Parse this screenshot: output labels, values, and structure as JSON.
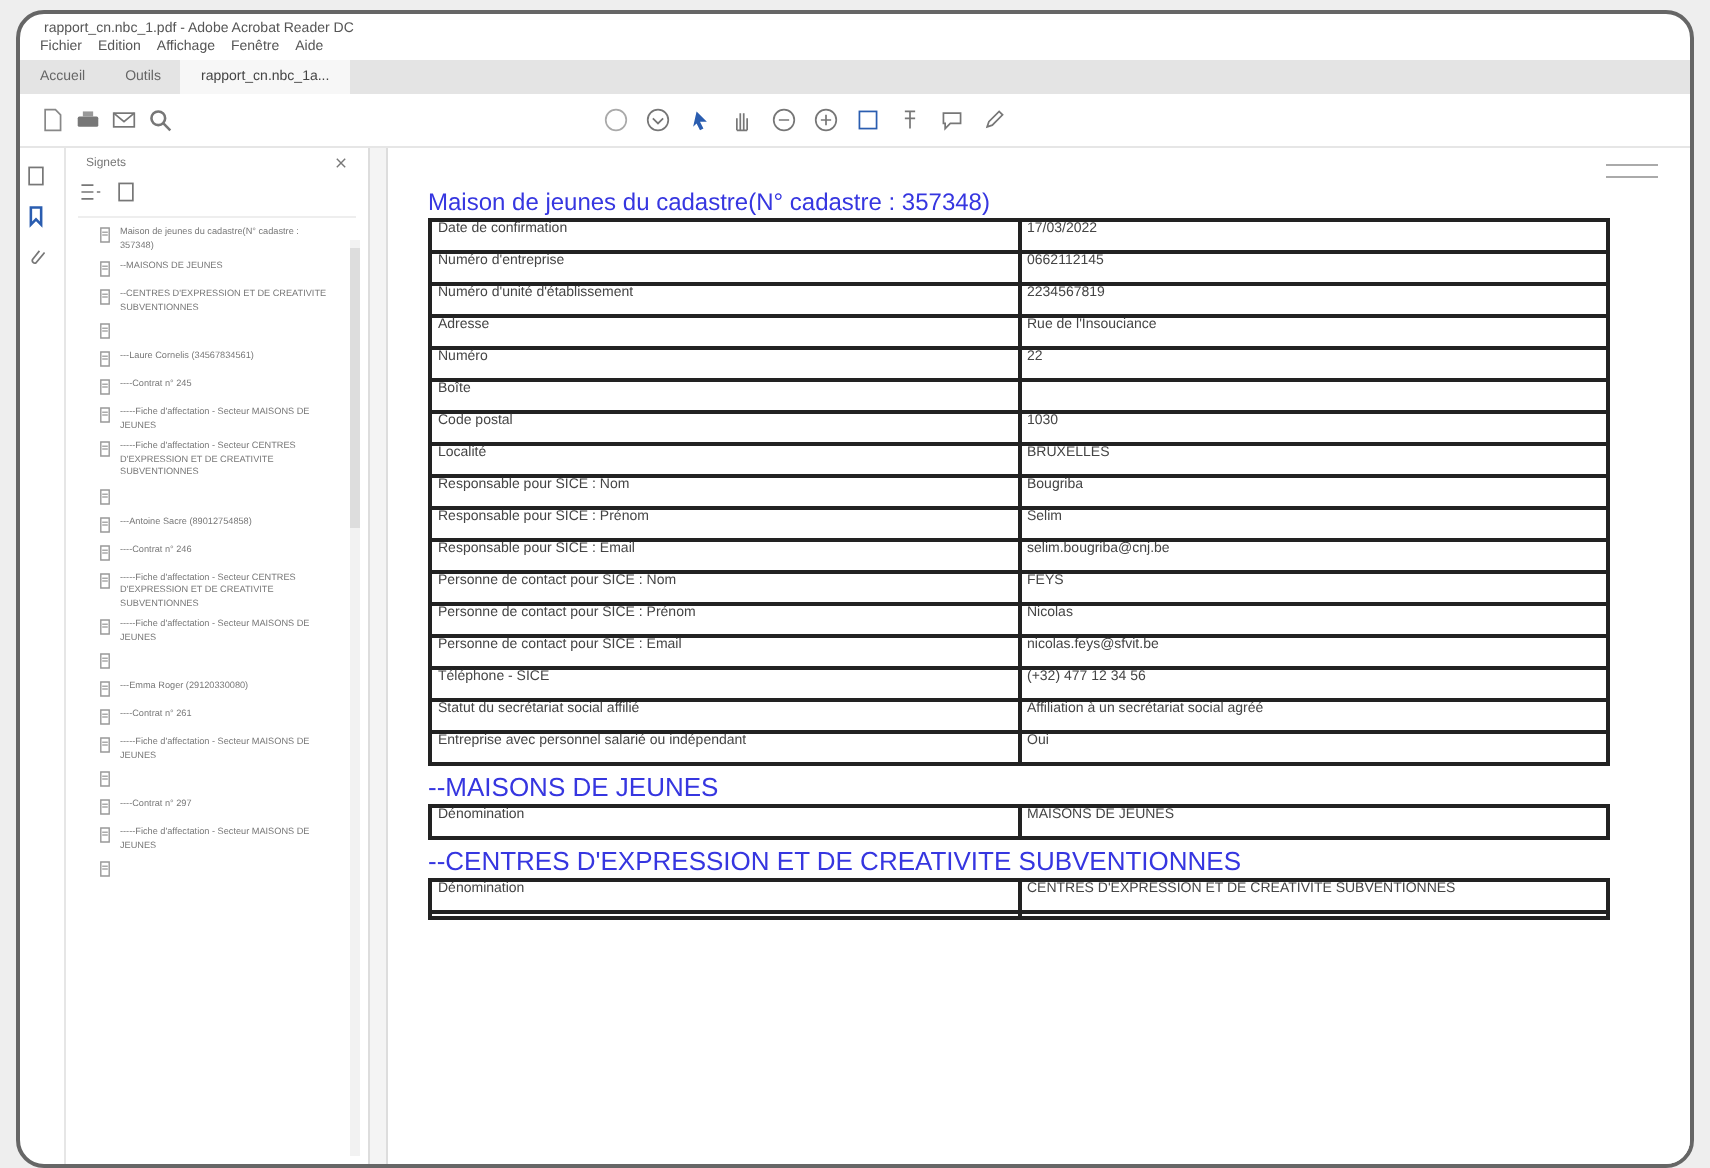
{
  "window": {
    "title": "rapport_cn.nbc_1.pdf - Adobe Acrobat Reader DC"
  },
  "menu": [
    "Fichier",
    "Edition",
    "Affichage",
    "Fenêtre",
    "Aide"
  ],
  "tabs": [
    {
      "label": "Accueil",
      "selected": false
    },
    {
      "label": "Outils",
      "selected": false
    },
    {
      "label": "rapport_cn.nbc_1a...",
      "selected": true
    }
  ],
  "sidebar": {
    "title": "Signets",
    "items": [
      {
        "kind": "labeled",
        "label": "Maison de jeunes du cadastre(N° cadastre : 357348)"
      },
      {
        "kind": "labeled",
        "label": "--MAISONS DE JEUNES"
      },
      {
        "kind": "labeled",
        "label": "--CENTRES D'EXPRESSION ET DE CREATIVITE SUBVENTIONNES"
      },
      {
        "kind": "unlabeled"
      },
      {
        "kind": "labeled",
        "label": "---Laure Cornelis (34567834561)"
      },
      {
        "kind": "labeled",
        "label": "----Contrat n° 245"
      },
      {
        "kind": "labeled",
        "label": "-----Fiche d'affectation - Secteur MAISONS DE JEUNES"
      },
      {
        "kind": "labeled",
        "label": "-----Fiche d'affectation - Secteur CENTRES D'EXPRESSION ET DE CREATIVITE SUBVENTIONNES"
      },
      {
        "kind": "unlabeled"
      },
      {
        "kind": "labeled",
        "label": "---Antoine Sacre (89012754858)"
      },
      {
        "kind": "labeled",
        "label": "----Contrat n° 246"
      },
      {
        "kind": "labeled",
        "label": "-----Fiche d'affectation - Secteur CENTRES D'EXPRESSION ET DE CREATIVITE SUBVENTIONNES"
      },
      {
        "kind": "labeled",
        "label": "-----Fiche d'affectation - Secteur MAISONS DE JEUNES"
      },
      {
        "kind": "unlabeled"
      },
      {
        "kind": "labeled",
        "label": "---Emma Roger (29120330080)"
      },
      {
        "kind": "labeled",
        "label": "----Contrat n° 261"
      },
      {
        "kind": "labeled",
        "label": "-----Fiche d'affectation - Secteur MAISONS DE JEUNES"
      },
      {
        "kind": "unlabeled"
      },
      {
        "kind": "labeled",
        "label": "----Contrat n° 297"
      },
      {
        "kind": "labeled",
        "label": "-----Fiche d'affectation - Secteur MAISONS DE JEUNES"
      },
      {
        "kind": "unlabeled"
      }
    ]
  },
  "document": {
    "title": "Maison de jeunes du cadastre(N° cadastre : 357348)",
    "rows": [
      [
        "Date de confirmation",
        "17/03/2022"
      ],
      [
        "Numéro d'entreprise",
        "0662112145"
      ],
      [
        "Numéro d'unité d'établissement",
        "2234567819"
      ],
      [
        "Adresse",
        "Rue de l'Insouciance"
      ],
      [
        "Numéro",
        "22"
      ],
      [
        "Boîte",
        null
      ],
      [
        "Code postal",
        "1030"
      ],
      [
        "Localité",
        "BRUXELLES"
      ],
      [
        "Responsable pour SICE : Nom",
        "Bougriba"
      ],
      [
        "Responsable pour SICE : Prénom",
        "Selim"
      ],
      [
        "Responsable pour SICE : Email",
        "selim.bougriba@cnj.be"
      ],
      [
        "Personne de contact pour SICE : Nom",
        "FEYS"
      ],
      [
        "Personne de contact pour SICE : Prénom",
        "Nicolas"
      ],
      [
        "Personne de contact pour SICE : Email",
        "nicolas.feys@sfvit.be"
      ],
      [
        "Téléphone - SICE",
        "(+32) 477 12 34 56"
      ],
      [
        "Statut du secrétariat social affilié",
        "Affiliation à un secrétariat social agréé"
      ],
      [
        "Entreprise avec personnel salarié ou indépendant",
        "Oui"
      ]
    ],
    "sections": [
      {
        "heading": "--MAISONS DE JEUNES",
        "rows": [
          [
            "Dénomination",
            "MAISONS DE JEUNES"
          ]
        ]
      },
      {
        "heading": "--CENTRES D'EXPRESSION ET DE CREATIVITE SUBVENTIONNES",
        "rows": [
          [
            "Dénomination",
            "CENTRES D'EXPRESSION ET DE CREATIVITE SUBVENTIONNES"
          ],
          [
            null,
            null
          ]
        ]
      }
    ]
  }
}
